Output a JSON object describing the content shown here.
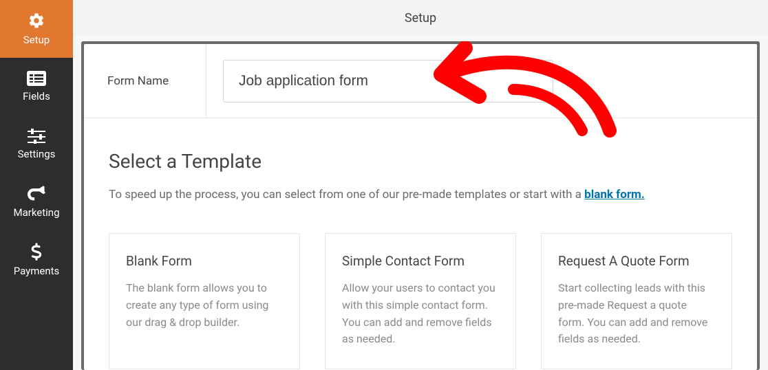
{
  "sidebar": {
    "items": [
      {
        "label": "Setup"
      },
      {
        "label": "Fields"
      },
      {
        "label": "Settings"
      },
      {
        "label": "Marketing"
      },
      {
        "label": "Payments"
      }
    ]
  },
  "topbar": {
    "title": "Setup"
  },
  "form_name": {
    "label": "Form Name",
    "value": "Job application form"
  },
  "templates": {
    "heading": "Select a Template",
    "intro_prefix": "To speed up the process, you can select from one of our pre-made templates or start with a ",
    "blank_link": "blank form.",
    "cards": [
      {
        "title": "Blank Form",
        "desc": "The blank form allows you to create any type of form using our drag & drop builder."
      },
      {
        "title": "Simple Contact Form",
        "desc": "Allow your users to contact you with this simple contact form. You can add and remove fields as needed."
      },
      {
        "title": "Request A Quote Form",
        "desc": "Start collecting leads with this pre-made Request a quote form. You can add and remove fields as needed."
      }
    ]
  }
}
